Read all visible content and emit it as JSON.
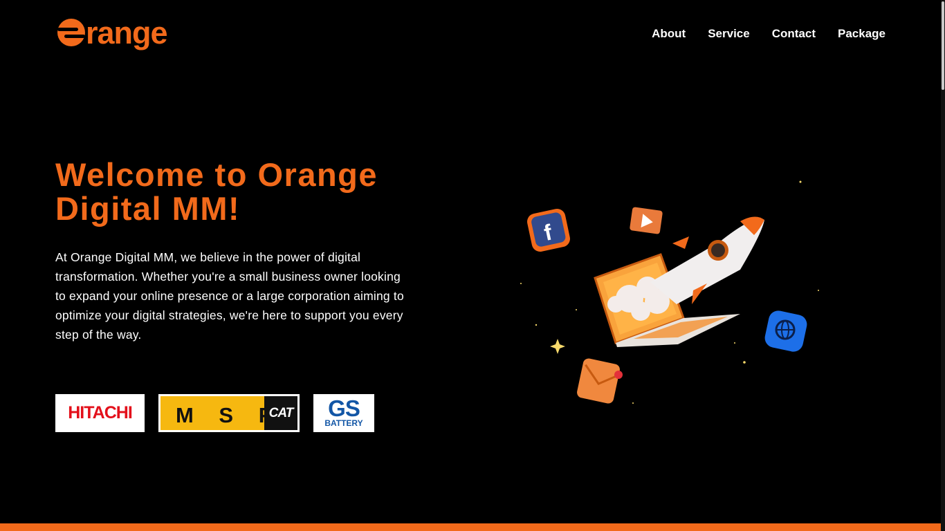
{
  "header": {
    "logo_text": "range",
    "logo_icon": "orange-logo-mark",
    "nav": [
      {
        "label": "About"
      },
      {
        "label": "Service"
      },
      {
        "label": "Contact"
      },
      {
        "label": "Package"
      }
    ]
  },
  "hero": {
    "title": "Welcome to Orange Digital MM!",
    "body": "At Orange Digital MM, we believe in the power of digital transformation. Whether you're a small business owner looking to expand your online presence or a large corporation aiming to optimize your digital strategies, we're here to support you every step of the way.",
    "illustration_icons": [
      "facebook-icon",
      "video-icon",
      "rocket-icon",
      "laptop-icon",
      "globe-icon",
      "mail-icon",
      "sparkle-icon"
    ]
  },
  "clients": {
    "hitachi": "HITACHI",
    "msp": "M S P",
    "cat": "CAT",
    "gs": "GS",
    "gs_sub": "BATTERY"
  },
  "colors": {
    "accent": "#f26a1b",
    "background": "#000000",
    "text": "#ffffff"
  }
}
